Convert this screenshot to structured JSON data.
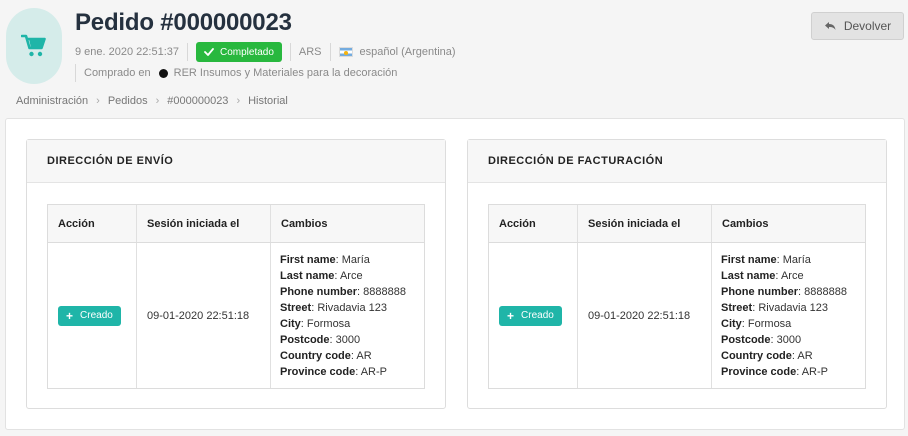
{
  "header": {
    "title": "Pedido #000000023",
    "date": "9 ene. 2020 22:51:37",
    "status": "Completado",
    "currency": "ARS",
    "language": "español (Argentina)",
    "purchased_in_label": "Comprado en",
    "store": "RER Insumos y Materiales para la decoración",
    "return_label": "Devolver"
  },
  "breadcrumb": [
    "Administración",
    "Pedidos",
    "#000000023",
    "Historial"
  ],
  "shipping": {
    "title": "DIRECCIÓN DE ENVÍO",
    "columns": [
      "Acción",
      "Sesión iniciada el",
      "Cambios"
    ],
    "action_label": "Creado",
    "session": "09-01-2020 22:51:18",
    "changes": [
      {
        "key": "First name",
        "value": "María"
      },
      {
        "key": "Last name",
        "value": "Arce"
      },
      {
        "key": "Phone number",
        "value": "8888888"
      },
      {
        "key": "Street",
        "value": "Rivadavia 123"
      },
      {
        "key": "City",
        "value": "Formosa"
      },
      {
        "key": "Postcode",
        "value": "3000"
      },
      {
        "key": "Country code",
        "value": "AR"
      },
      {
        "key": "Province code",
        "value": "AR-P"
      }
    ]
  },
  "billing": {
    "title": "DIRECCIÓN DE FACTURACIÓN",
    "columns": [
      "Acción",
      "Sesión iniciada el",
      "Cambios"
    ],
    "action_label": "Creado",
    "session": "09-01-2020 22:51:18",
    "changes": [
      {
        "key": "First name",
        "value": "María"
      },
      {
        "key": "Last name",
        "value": "Arce"
      },
      {
        "key": "Phone number",
        "value": "8888888"
      },
      {
        "key": "Street",
        "value": "Rivadavia 123"
      },
      {
        "key": "City",
        "value": "Formosa"
      },
      {
        "key": "Postcode",
        "value": "3000"
      },
      {
        "key": "Country code",
        "value": "AR"
      },
      {
        "key": "Province code",
        "value": "AR-P"
      }
    ]
  },
  "colors": {
    "accent": "#1fb5a8",
    "status_green": "#28b83e",
    "icon_bg": "#d5ecea"
  },
  "icons": {
    "order": "cart-icon",
    "status": "check-icon",
    "return": "reply-icon",
    "flag": "flag-argentina-icon",
    "action": "plus-icon"
  }
}
